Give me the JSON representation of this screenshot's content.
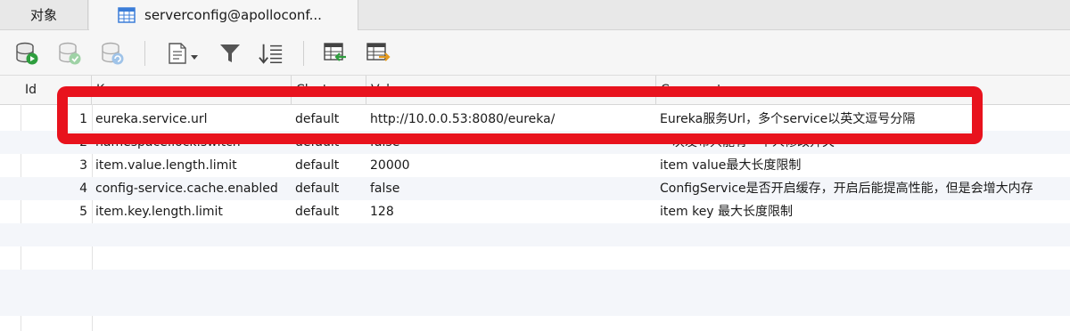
{
  "tabs": [
    {
      "label": "对象"
    },
    {
      "label": "serverconfig@apolloconf..."
    }
  ],
  "toolbar": {
    "buttons": [
      "add-record-icon",
      "apply-changes-icon",
      "discard-changes-icon",
      "text-view-icon",
      "filter-icon",
      "sort-icon",
      "import-icon",
      "export-icon"
    ]
  },
  "columns": [
    "Id",
    "Key",
    "Cluster",
    "Value",
    "Comment"
  ],
  "rows": [
    {
      "id": "1",
      "key": "eureka.service.url",
      "cluster": "default",
      "value": "http://10.0.0.53:8080/eureka/",
      "comment": "Eureka服务Url，多个service以英文逗号分隔"
    },
    {
      "id": "2",
      "key": "namespace.lock.switch",
      "cluster": "default",
      "value": "false",
      "comment": "一次发布只能有一个人修改开关"
    },
    {
      "id": "3",
      "key": "item.value.length.limit",
      "cluster": "default",
      "value": "20000",
      "comment": "item value最大长度限制"
    },
    {
      "id": "4",
      "key": "config-service.cache.enabled",
      "cluster": "default",
      "value": "false",
      "comment": "ConfigService是否开启缓存，开启后能提高性能，但是会增大内存"
    },
    {
      "id": "5",
      "key": "item.key.length.limit",
      "cluster": "default",
      "value": "128",
      "comment": "item key 最大长度限制"
    }
  ],
  "colors": {
    "highlight": "#e8121d",
    "accent_icon": "#2e9e3e"
  }
}
